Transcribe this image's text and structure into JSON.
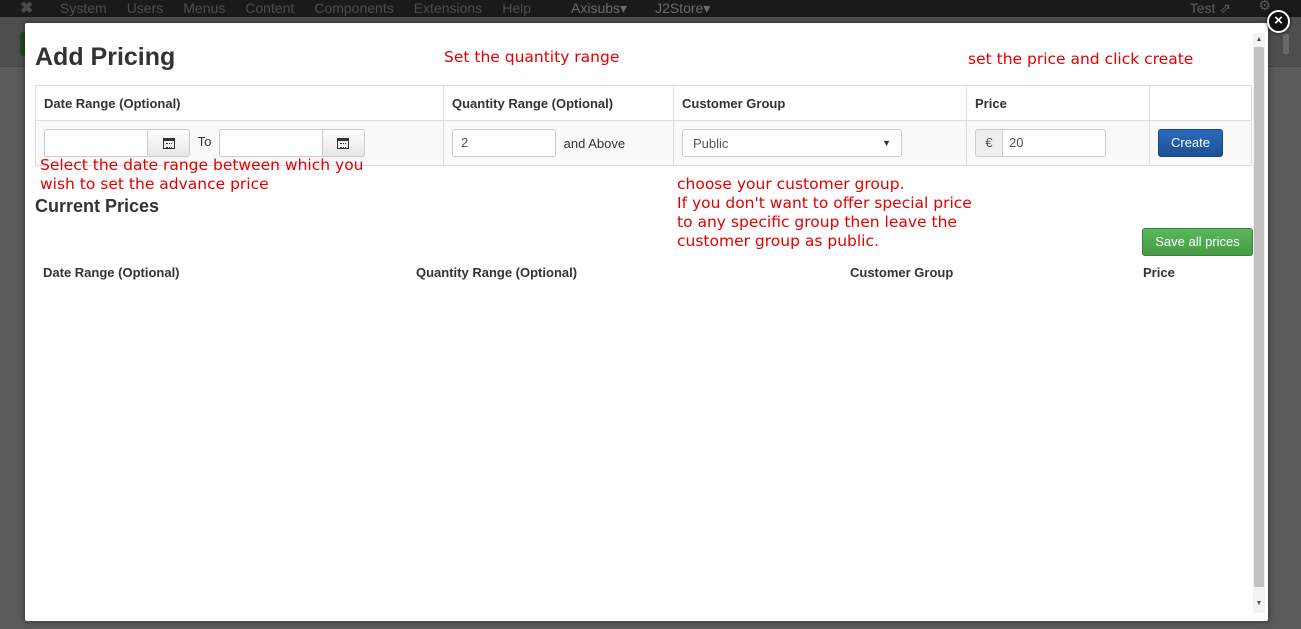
{
  "topbar": {
    "menu": [
      "System",
      "Users",
      "Menus",
      "Content",
      "Components",
      "Extensions",
      "Help",
      "Axisubs▾",
      "J2Store▾"
    ],
    "user": "Test"
  },
  "modal": {
    "title": "Add Pricing",
    "close": "×",
    "annotations": {
      "quantity": "Set the quantity range",
      "price": "set the price and click create",
      "date": "Select the date range between which you\n wish to set the advance price",
      "group": "choose your customer group.\nIf you don't want to offer special price\nto any specific group then leave the\ncustomer group as public."
    },
    "add_table": {
      "headers": [
        "Date Range (Optional)",
        "Quantity Range (Optional)",
        "Customer Group",
        "Price",
        ""
      ],
      "to_label": "To",
      "quantity_value": "2",
      "and_above": "and Above",
      "customer_group": "Public",
      "currency": "€",
      "price_value": "20",
      "create_label": "Create"
    },
    "current": {
      "title": "Current Prices",
      "save_label": "Save all prices",
      "headers": [
        "Date Range (Optional)",
        "Quantity Range (Optional)",
        "Customer Group",
        "Price"
      ]
    }
  }
}
